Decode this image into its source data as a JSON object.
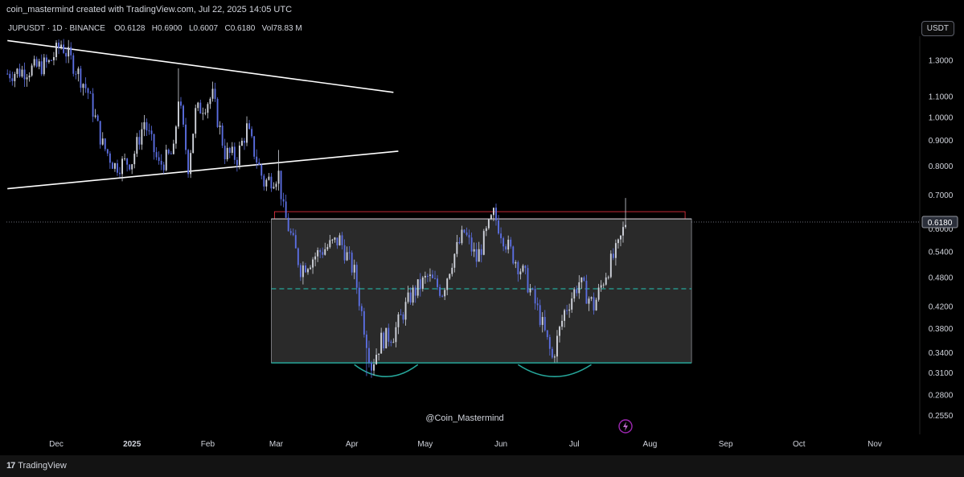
{
  "header": {
    "credit": "coin_mastermind created with TradingView.com, Jul 22, 2025 14:05 UTC",
    "symbol_line": "JUPUSDT · 1D · BINANCE",
    "open_label": "O",
    "open": "0.6128",
    "high_label": "H",
    "high": "0.6900",
    "low_label": "L",
    "low": "0.6007",
    "close_label": "C",
    "close": "0.6180",
    "vol_label": "Vol",
    "vol": "78.83 M",
    "currency_button": "USDT"
  },
  "watermark": "@Coin_Mastermind",
  "footer": {
    "brand": "TradingView",
    "brand_mark": "17"
  },
  "colors": {
    "bull": "#d1d4dc",
    "bear": "#5b6ee1",
    "box_fill": "#2a2a2a",
    "box_border": "#b2b5be",
    "support": "#26a69a",
    "resistance_box": "#f23645",
    "trendline": "#ffffff",
    "grid_text": "#d1d4dc"
  },
  "chart_data": {
    "type": "candlestick",
    "title": "",
    "xlabel": "",
    "ylabel": "",
    "log_scale": true,
    "ylim": [
      0.235,
      1.48
    ],
    "y_ticks": [
      "1.3000",
      "1.1000",
      "1.0000",
      "0.9000",
      "0.8000",
      "0.7000",
      "0.6000",
      "0.5400",
      "0.4800",
      "0.4200",
      "0.3800",
      "0.3400",
      "0.3100",
      "0.2800",
      "0.2550"
    ],
    "x_ticks": [
      "Dec",
      "2025",
      "Feb",
      "Mar",
      "Apr",
      "May",
      "Jun",
      "Jul",
      "Aug",
      "Sep",
      "Oct",
      "Nov"
    ],
    "last_price": "0.6180",
    "range_box": {
      "from": "2025-02-27",
      "to": "2025-08-18",
      "top": 0.627,
      "bottom": 0.324,
      "midline": 0.455
    },
    "resistance_zone": {
      "from": "2025-02-27",
      "to": "2025-08-18",
      "top": 0.648,
      "bottom": 0.627
    },
    "trendlines": [
      {
        "from": [
          "2024-11-11",
          1.42
        ],
        "to": [
          "2025-04-18",
          1.12
        ]
      },
      {
        "from": [
          "2024-11-11",
          0.72
        ],
        "to": [
          "2025-04-20",
          0.855
        ]
      }
    ],
    "cup_arcs": [
      {
        "from": "2025-04-02",
        "to": "2025-04-28",
        "low": 0.303
      },
      {
        "from": "2025-06-08",
        "to": "2025-07-08",
        "low": 0.303
      }
    ],
    "price_path": [
      [
        "2024-11-11",
        1.22
      ],
      [
        "2024-11-22",
        1.25
      ],
      [
        "2024-11-28",
        1.28
      ],
      [
        "2024-12-03",
        1.4
      ],
      [
        "2024-12-09",
        1.25
      ],
      [
        "2024-12-14",
        1.12
      ],
      [
        "2024-12-20",
        0.88
      ],
      [
        "2024-12-25",
        0.8
      ],
      [
        "2025-01-01",
        0.82
      ],
      [
        "2025-01-06",
        0.98
      ],
      [
        "2025-01-12",
        0.8
      ],
      [
        "2025-01-18",
        0.85
      ],
      [
        "2025-01-20",
        1.1
      ],
      [
        "2025-01-24",
        0.8
      ],
      [
        "2025-01-27",
        1.02
      ],
      [
        "2025-02-03",
        1.1
      ],
      [
        "2025-02-08",
        0.85
      ],
      [
        "2025-02-13",
        0.83
      ],
      [
        "2025-02-17",
        0.95
      ],
      [
        "2025-02-24",
        0.74
      ],
      [
        "2025-03-02",
        0.77
      ],
      [
        "2025-03-04",
        0.65
      ],
      [
        "2025-03-11",
        0.5
      ],
      [
        "2025-03-19",
        0.54
      ],
      [
        "2025-03-27",
        0.57
      ],
      [
        "2025-04-02",
        0.49
      ],
      [
        "2025-04-07",
        0.36
      ],
      [
        "2025-04-09",
        0.32
      ],
      [
        "2025-04-13",
        0.36
      ],
      [
        "2025-04-18",
        0.37
      ],
      [
        "2025-04-25",
        0.44
      ],
      [
        "2025-05-02",
        0.48
      ],
      [
        "2025-05-08",
        0.45
      ],
      [
        "2025-05-12",
        0.52
      ],
      [
        "2025-05-17",
        0.59
      ],
      [
        "2025-05-22",
        0.52
      ],
      [
        "2025-05-29",
        0.64
      ],
      [
        "2025-06-04",
        0.55
      ],
      [
        "2025-06-11",
        0.48
      ],
      [
        "2025-06-17",
        0.4
      ],
      [
        "2025-06-22",
        0.33
      ],
      [
        "2025-06-27",
        0.41
      ],
      [
        "2025-07-03",
        0.47
      ],
      [
        "2025-07-09",
        0.42
      ],
      [
        "2025-07-14",
        0.49
      ],
      [
        "2025-07-19",
        0.55
      ],
      [
        "2025-07-22",
        0.618
      ]
    ],
    "high_spikes": [
      [
        "2024-12-03",
        1.42
      ],
      [
        "2025-01-20",
        1.25
      ],
      [
        "2025-03-02",
        0.86
      ],
      [
        "2025-05-29",
        0.655
      ],
      [
        "2025-07-22",
        0.69
      ]
    ],
    "low_spikes": [
      [
        "2025-04-07",
        0.305
      ],
      [
        "2025-06-22",
        0.33
      ]
    ]
  }
}
